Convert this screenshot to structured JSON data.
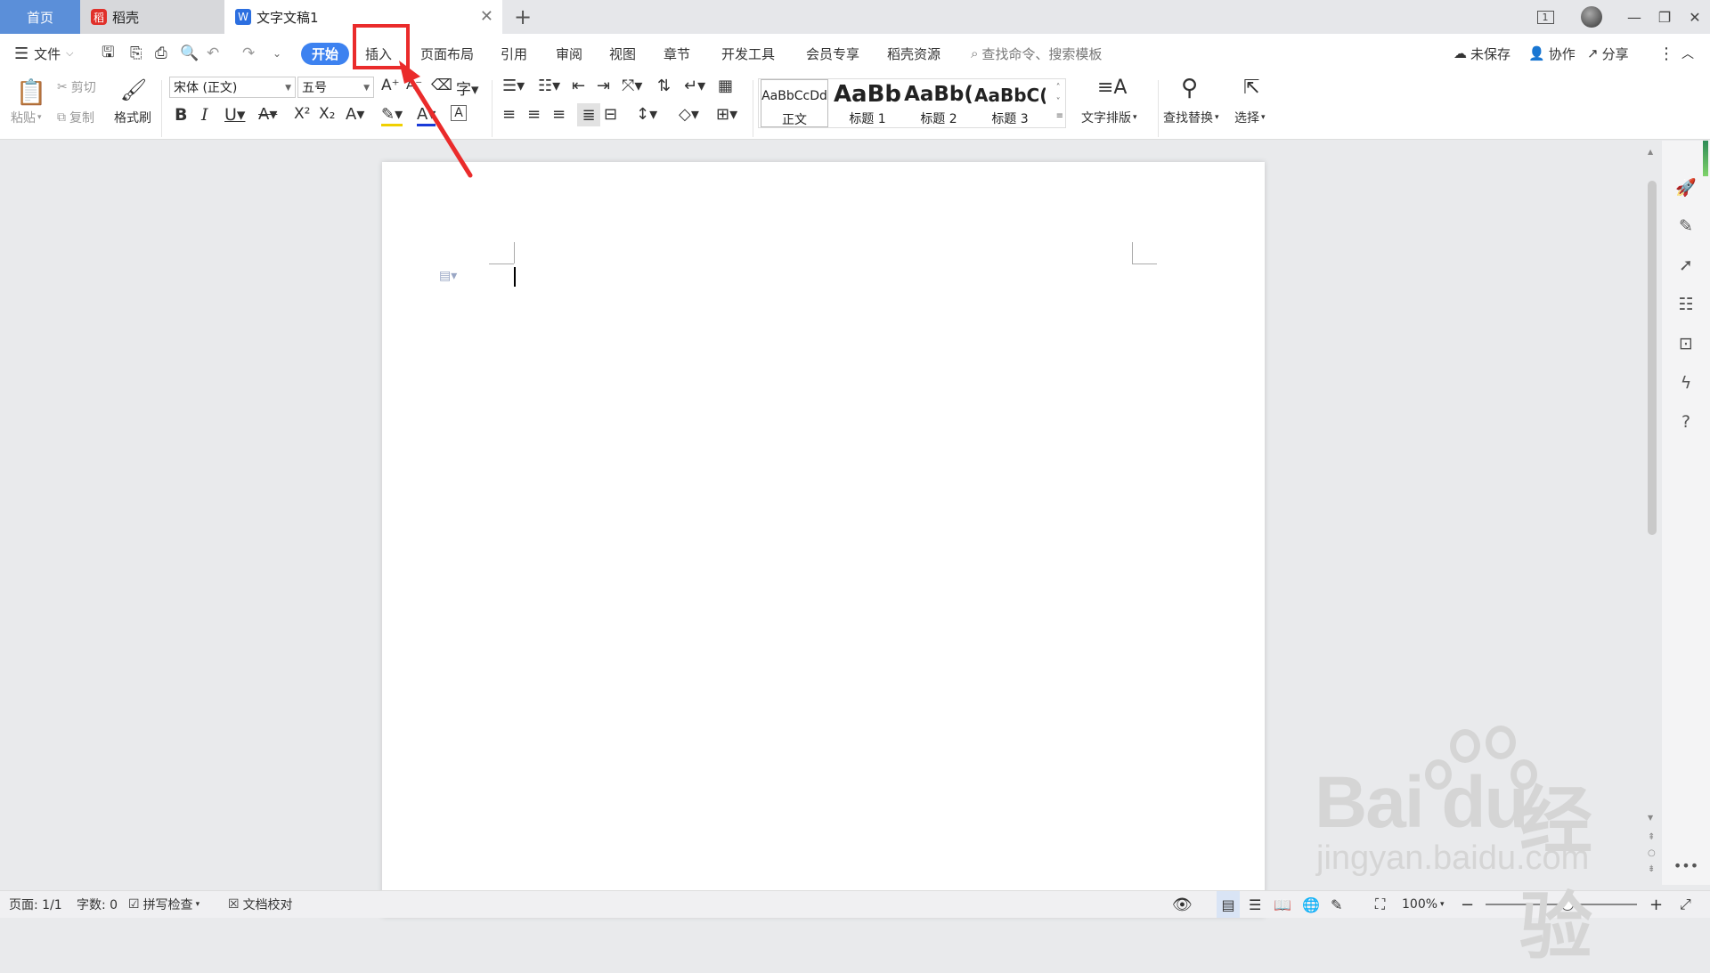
{
  "tabs": {
    "home": "首页",
    "daoke": "稻壳",
    "doc": "文字文稿1",
    "add": "+"
  },
  "titlebar": {
    "page_indicator": "1"
  },
  "menu": {
    "file": "文件",
    "items": [
      "开始",
      "插入",
      "页面布局",
      "引用",
      "审阅",
      "视图",
      "章节",
      "开发工具",
      "会员专享",
      "稻壳资源"
    ],
    "search_placeholder": "查找命令、搜索模板",
    "unsaved": "未保存",
    "collab": "协作",
    "share": "分享"
  },
  "ribbon": {
    "paste": "粘贴",
    "cut": "剪切",
    "copy": "复制",
    "format_painter": "格式刷",
    "font": "宋体 (正文)",
    "size": "五号",
    "styles": [
      {
        "sample": "AaBbCcDd",
        "name": "正文"
      },
      {
        "sample": "AaBb",
        "name": "标题 1"
      },
      {
        "sample": "AaBb(",
        "name": "标题 2"
      },
      {
        "sample": "AaBbC(",
        "name": "标题 3"
      }
    ],
    "text_layout": "文字排版",
    "find_replace": "查找替换",
    "select": "选择"
  },
  "status": {
    "page": "页面: 1/1",
    "words": "字数: 0",
    "spell": "拼写检查",
    "proof": "文档校对",
    "zoom": "100%"
  },
  "watermark": {
    "brand": "Bai du 经验",
    "url": "jingyan.baidu.com"
  },
  "colors": {
    "accent": "#3d82f0",
    "annotation": "#ea2b2b",
    "home_tab": "#5b8fd9"
  }
}
